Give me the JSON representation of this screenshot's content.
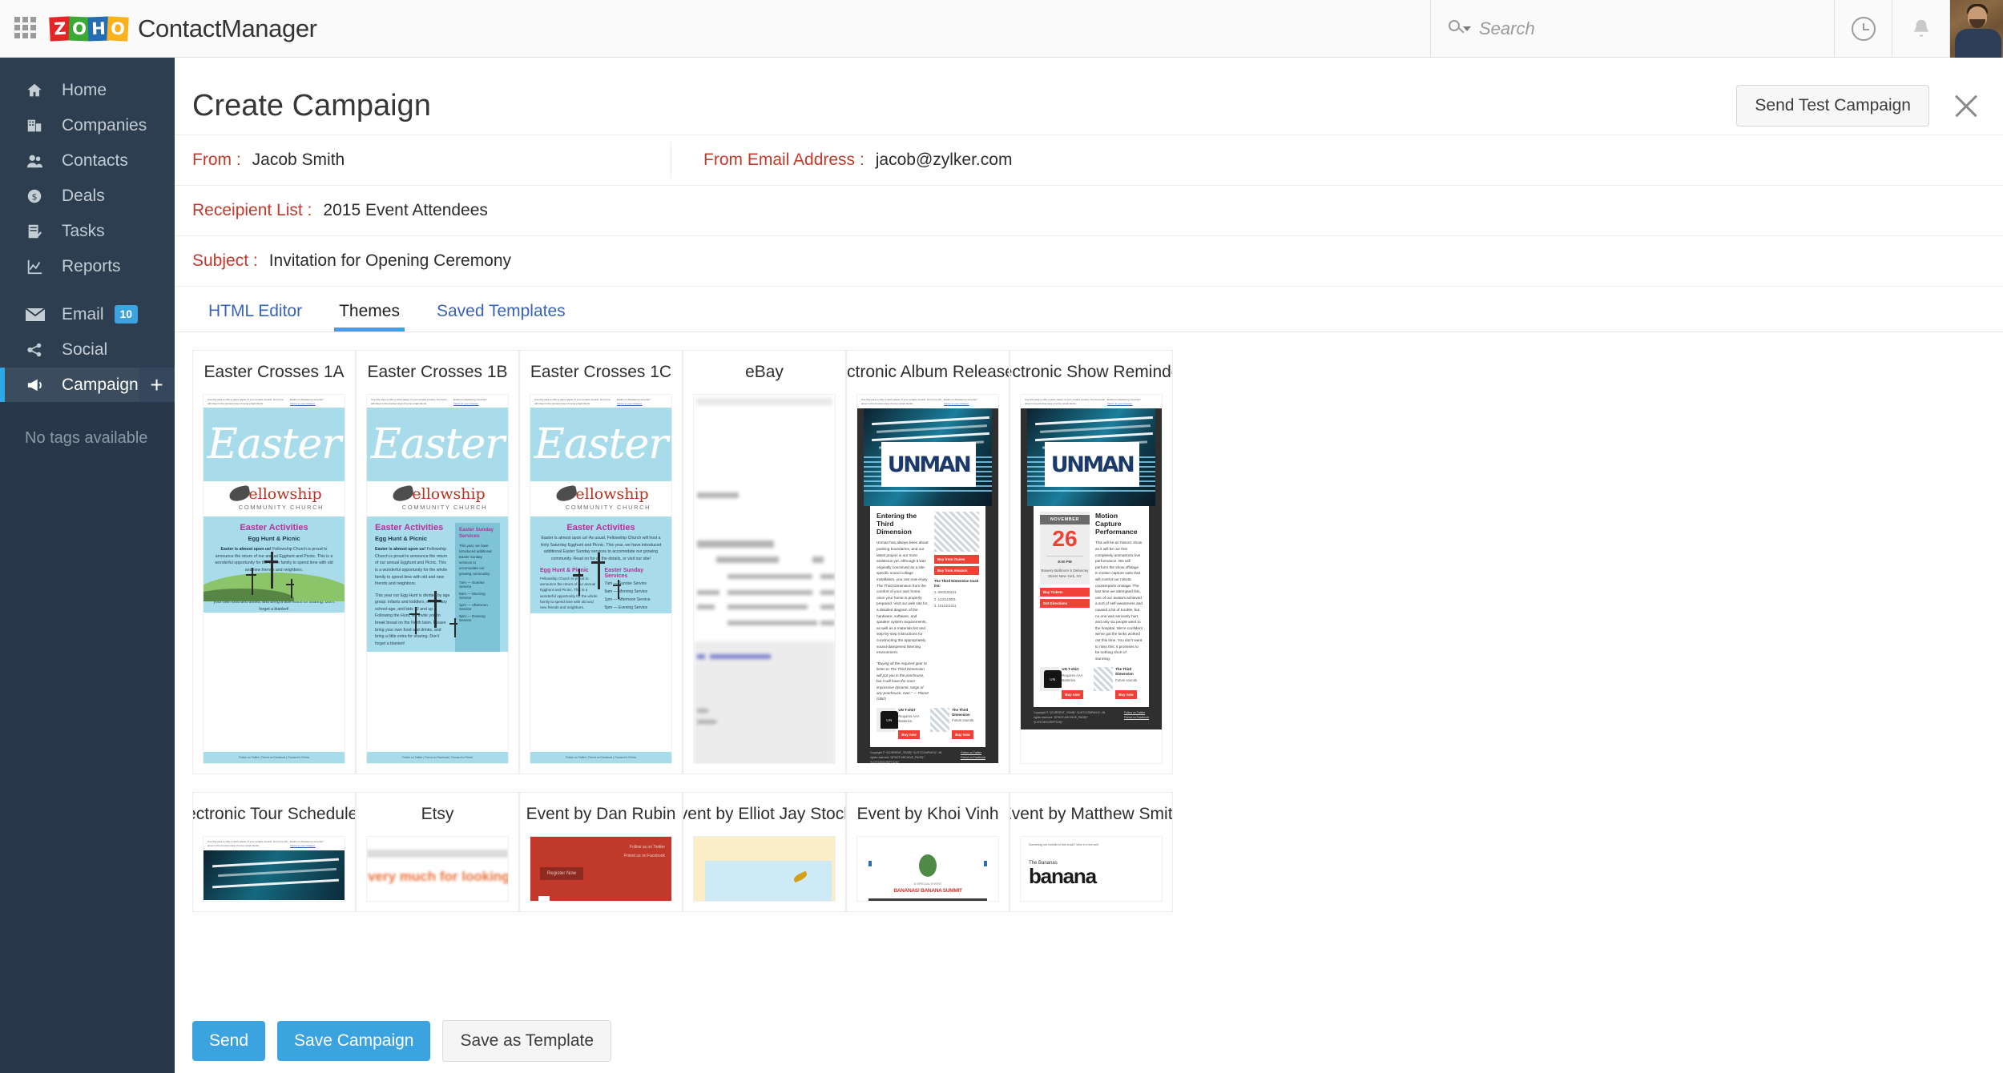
{
  "topbar": {
    "apps_icon": "grid-apps-icon",
    "brand_zoho": [
      "Z",
      "O",
      "H",
      "O"
    ],
    "app_name": "ContactManager",
    "search_placeholder": "Search",
    "search_value": "",
    "history_icon": "clock-icon",
    "notification_icon": "bell-icon",
    "avatar": "user-avatar"
  },
  "sidebar": {
    "items": [
      {
        "label": "Home",
        "icon": "home-icon",
        "badge": null,
        "active": false
      },
      {
        "label": "Companies",
        "icon": "building-icon",
        "badge": null,
        "active": false
      },
      {
        "label": "Contacts",
        "icon": "people-icon",
        "badge": null,
        "active": false
      },
      {
        "label": "Deals",
        "icon": "dollar-circle-icon",
        "badge": null,
        "active": false
      },
      {
        "label": "Tasks",
        "icon": "checklist-icon",
        "badge": null,
        "active": false
      },
      {
        "label": "Reports",
        "icon": "chart-icon",
        "badge": null,
        "active": false
      },
      {
        "label": "Email",
        "icon": "envelope-icon",
        "badge": "10",
        "active": false
      },
      {
        "label": "Social",
        "icon": "share-nodes-icon",
        "badge": null,
        "active": false
      },
      {
        "label": "Campaigns",
        "icon": "megaphone-icon",
        "badge": null,
        "active": true
      }
    ],
    "add_button": "+",
    "tags_empty": "No tags available"
  },
  "page": {
    "title": "Create Campaign",
    "send_test_label": "Send Test Campaign",
    "close_icon": "close-icon"
  },
  "form": {
    "from_label": "From :",
    "from_value": "Jacob Smith",
    "from_email_label": "From Email Address :",
    "from_email_value": "jacob@zylker.com",
    "recipient_label": "Receipient List :",
    "recipient_value": "2015 Event Attendees",
    "subject_label": "Subject :",
    "subject_value": "Invitation for Opening Ceremony"
  },
  "tabs": [
    {
      "label": "HTML Editor",
      "active": false
    },
    {
      "label": "Themes",
      "active": true
    },
    {
      "label": "Saved Templates",
      "active": false
    }
  ],
  "templates": [
    {
      "title": "Easter Crosses 1A",
      "kind": "easter-a"
    },
    {
      "title": "Easter Crosses 1B",
      "kind": "easter-b"
    },
    {
      "title": "Easter Crosses 1C",
      "kind": "easter-c"
    },
    {
      "title": "eBay",
      "kind": "ebay"
    },
    {
      "title": "Electronic Album Release ...",
      "kind": "unman-album"
    },
    {
      "title": "Electronic Show Reminde...",
      "kind": "unman-show"
    },
    {
      "title": "Electronic Tour Schedule ...",
      "kind": "tour"
    },
    {
      "title": "Etsy",
      "kind": "etsy"
    },
    {
      "title": "Event by Dan Rubin",
      "kind": "dan"
    },
    {
      "title": "Event by Elliot Jay Stocks",
      "kind": "elliot"
    },
    {
      "title": "Event by Khoi Vinh",
      "kind": "khoi"
    },
    {
      "title": "Event by Matthew Smith",
      "kind": "matthew"
    }
  ],
  "easter_preview": {
    "teaser_left": "Use this area to offer a short teaser of your email's content. Text here will show in the preview area of some email clients.",
    "teaser_right_line1": "Email not displaying correctly?",
    "teaser_right_link": "View it in your browser.",
    "wordmark": "Easter",
    "church_name": "Fellowship",
    "church_sub": "COMMUNITY CHURCH",
    "heading": "Easter Activities",
    "subheading": "Egg Hunt & Picnic",
    "para1_bold": "Easter is almost upon us!",
    "para1": " Fellowship Church is proud to announce the return of our annual Egghunt and Picnic. This is a wonderful opportunity for the whole family to spend time with old and new friends and neighbors.",
    "para2": "This year our Egg Hunt is divided by age group: infants and toddlers, elementary school-age, and kids 12 and up. Following the Hunt, we invite you to break bread on the North lawn. Please bring your own food and drinks, and bring a little extra for sharing. Don't forget a blanket!",
    "intro_c": "Easter is almost upon us! As usual, Fellowship Church will host a Holy Saturday Egghunt and Picnic. This year, we have introduced additional Easter Sunday services to accomodate our growing community. Read on for all the details, or visit our site!",
    "services_title": "Easter Sunday Services",
    "services_note": "This year, we have introduced additional Easter Sunday services to accomodate our growing community.",
    "services": [
      "7am — Sunrise Service",
      "9am — Morning Service",
      "1pm — Afternoon Service",
      "5pm — Evening Service"
    ],
    "footer_links": "Follow on Twitter | Friend on Facebook | Forward to Friend"
  },
  "unman_preview": {
    "teaser_left": "Use this area to offer a short teaser of your email's content. Text here will show in the preview area of some email clients.",
    "teaser_right_line1": "Email not displaying correctly?",
    "teaser_right_link": "View it in your browser.",
    "logo": "UNMAN",
    "album_heading": "Entering the Third Dimension",
    "album_body": "Unman has always been about pushing boundaries, and our latest project is our most ambitious yet. Although it was originally conceived as a site-specific sound collage installation, you can now enjoy The Third Dimension from the comfort of your own home, once your home is properly prepared. Visit our web site for a detailed diagram of the hardware, software, and speaker system requirements, as well as a materials list and step-by-step instructions for constructing the appropriately sound-dampened listening environment.",
    "album_quote": "\"Buying all the required gear to listen to The Third Dimension will put you in the poorhouse, but it will have the most impressive dynamic range of any poorhouse, ever.\" — Planet Glitch",
    "buy_itunes": "Buy from iTunes",
    "buy_amazon": "Buy from Amazon",
    "tracklist_title": "The Third Dimension track list:",
    "tracks": [
      "1. 0001100101",
      "2. 1110110001",
      "3. 1010101011"
    ],
    "show_heading": "Motion Capture Performance",
    "show_month": "NOVEMBER",
    "show_day": "26",
    "show_time": "8:00 PM",
    "show_venue": "Bowery Ballroom 6 Delancey Street New York, NY",
    "show_body": "This will be an historic show as it will be our first completely animatronic live performance. We will perform the show offstage in motion capture suits that will control our robotic counterparts onstage. The last time we attempted this, one of our avatars achieved a sort of self-awareness and caused a bit of trouble, but no one was seriously hurt, and only six people went to the hospital. We're confident we've got the kinks worked out this time. You don't want to miss this; it promises to be nothing short of stunning.",
    "buy_tickets": "Buy Tickets",
    "get_directions": "Get Directions",
    "prod1_name": "UN T-shirt",
    "prod1_desc": "Requires AAA Batteries.",
    "prod2_name": "The Third Dimension",
    "prod2_desc": "Future sounds.",
    "buy_now": "Buy now",
    "copyright": "Copyright © *|CURRENT_YEAR|* *|LIST:COMPANY|*, All rights reserved. *|IFNOT:ARCHIVE_PAGE|* *|LIST:DESCRIPTION|*",
    "social1": "Follow on Twitter",
    "social2": "Friend on Facebook"
  },
  "misc_previews": {
    "etsy_text": "u very much for looking a",
    "dan_button": "Register Now",
    "dan_social1": "Follow us on Twitter",
    "dan_social2": "Friend us on Facebook",
    "khoi_caption": "A SPECIAL EVENT",
    "khoi_red": "BANANAS! BANANA SUMMIT",
    "matthew_small": "Something not horrible in this email? View it in the web",
    "matthew_k1": "The Bananas",
    "matthew_k2": "banana"
  },
  "footer": {
    "send_label": "Send",
    "save_campaign_label": "Save Campaign",
    "save_template_label": "Save as Template"
  },
  "colors": {
    "accent_blue": "#3ba4e0",
    "sidebar_bg": "#2d3e50",
    "label_red": "#c0392b",
    "link_blue": "#3a63b8"
  }
}
